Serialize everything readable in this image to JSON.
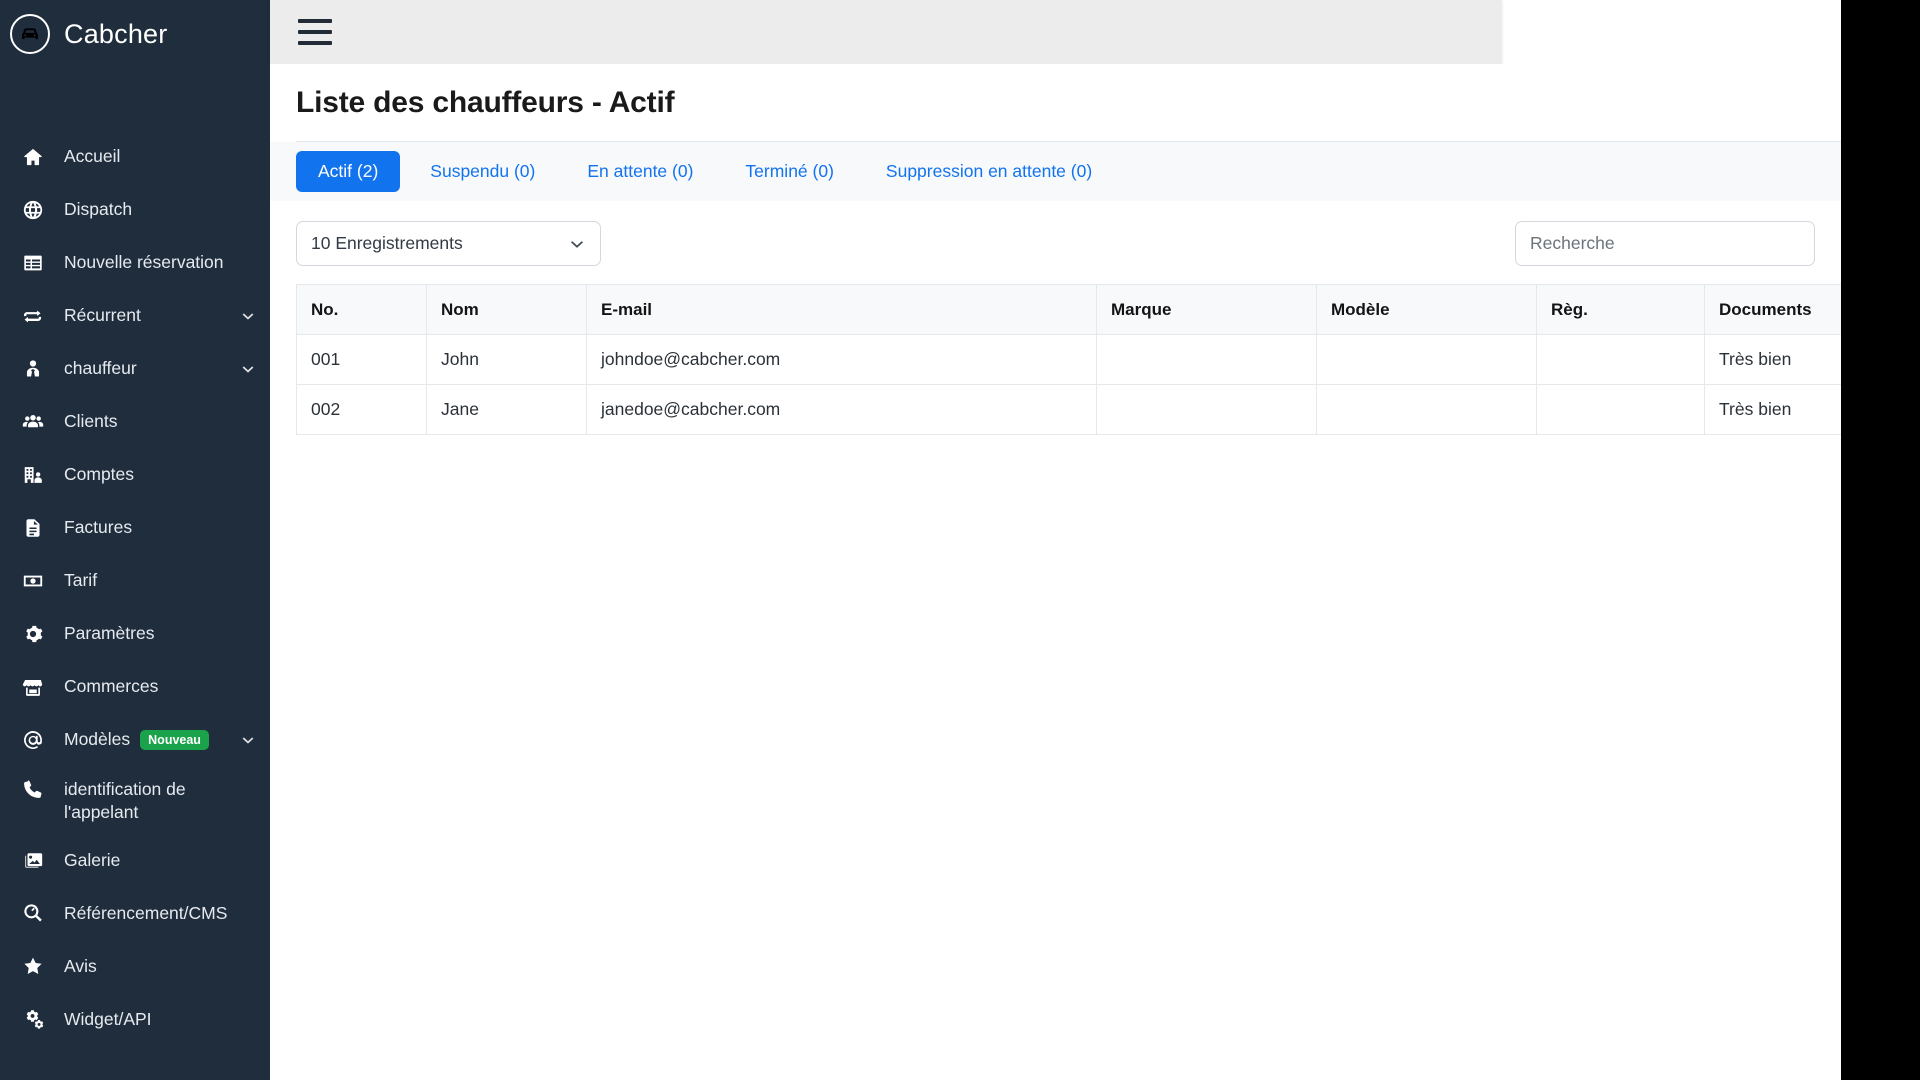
{
  "brand": {
    "name": "Cabcher",
    "logo_icon": "taxi-car-icon"
  },
  "sidebar": {
    "items": [
      {
        "label": "Accueil",
        "icon": "home-icon",
        "badge": null,
        "caret": false
      },
      {
        "label": "Dispatch",
        "icon": "globe-icon",
        "badge": null,
        "caret": false
      },
      {
        "label": "Nouvelle réservation",
        "icon": "table-icon",
        "badge": null,
        "caret": false
      },
      {
        "label": "Récurrent",
        "icon": "repeat-icon",
        "badge": null,
        "caret": true
      },
      {
        "label": "chauffeur",
        "icon": "driver-tie-icon",
        "badge": null,
        "caret": true
      },
      {
        "label": "Clients",
        "icon": "users-icon",
        "badge": null,
        "caret": false
      },
      {
        "label": "Comptes",
        "icon": "building-user-icon",
        "badge": null,
        "caret": false
      },
      {
        "label": "Factures",
        "icon": "invoice-file-icon",
        "badge": null,
        "caret": false
      },
      {
        "label": "Tarif",
        "icon": "money-bill-icon",
        "badge": null,
        "caret": false
      },
      {
        "label": "Paramètres",
        "icon": "gear-icon",
        "badge": null,
        "caret": false
      },
      {
        "label": "Commerces",
        "icon": "store-icon",
        "badge": null,
        "caret": false
      },
      {
        "label": "Modèles",
        "icon": "at-sign-icon",
        "badge": "Nouveau",
        "caret": true
      },
      {
        "label": "identification de l'appelant",
        "icon": "phone-icon",
        "badge": null,
        "caret": false
      },
      {
        "label": "Galerie",
        "icon": "image-icon",
        "badge": null,
        "caret": false
      },
      {
        "label": "Référencement/CMS",
        "icon": "search-magnifier-icon",
        "badge": null,
        "caret": false
      },
      {
        "label": "Avis",
        "icon": "star-icon",
        "badge": null,
        "caret": false
      },
      {
        "label": "Widget/API",
        "icon": "cogs-icon",
        "badge": null,
        "caret": false
      }
    ]
  },
  "topbar": {
    "menu_icon": "hamburger-icon"
  },
  "page": {
    "title": "Liste des chauffeurs - Actif"
  },
  "tabs": [
    {
      "label": "Actif (2)",
      "active": true
    },
    {
      "label": "Suspendu (0)",
      "active": false
    },
    {
      "label": "En attente (0)",
      "active": false
    },
    {
      "label": "Terminé (0)",
      "active": false
    },
    {
      "label": "Suppression en attente (0)",
      "active": false
    }
  ],
  "toolbar": {
    "records_select_value": "10 Enregistrements",
    "records_caret_icon": "chevron-down-icon",
    "search_placeholder": "Recherche",
    "search_value": ""
  },
  "table": {
    "columns": [
      "No.",
      "Nom",
      "E-mail",
      "Marque",
      "Modèle",
      "Règ.",
      "Documents"
    ],
    "rows": [
      {
        "no": "001",
        "nom": "John",
        "email": "johndoe@cabcher.com",
        "marque": "",
        "modele": "",
        "reg": "",
        "documents": "Très bien"
      },
      {
        "no": "002",
        "nom": "Jane",
        "email": "janedoe@cabcher.com",
        "marque": "",
        "modele": "",
        "reg": "",
        "documents": "Très bien"
      }
    ]
  },
  "colors": {
    "sidebar_bg": "#1f2d3d",
    "accent_blue": "#1273ef",
    "badge_green": "#1aa34a",
    "doc_green": "#1d7a4c",
    "topbar_bg": "#ececec"
  }
}
